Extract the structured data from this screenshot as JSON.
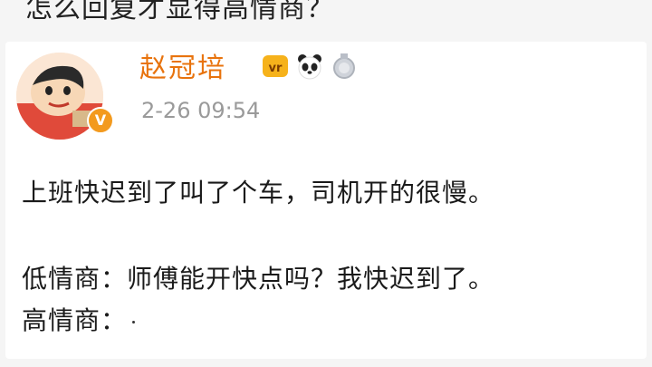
{
  "question": "怎么回复才显得高情商？",
  "post": {
    "username": "赵冠培",
    "timestamp": "2-26 09:54",
    "badges": [
      "vip-badge",
      "panda-badge",
      "medal-badge"
    ],
    "lines": [
      "上班快迟到了叫了个车，司机开的很慢。",
      "低情商：师傅能开快点吗？我快迟到了。",
      "高情商："
    ]
  },
  "colors": {
    "username": "#e8730d",
    "timestamp": "#9a9a9a",
    "verified": "#f39a1e"
  }
}
